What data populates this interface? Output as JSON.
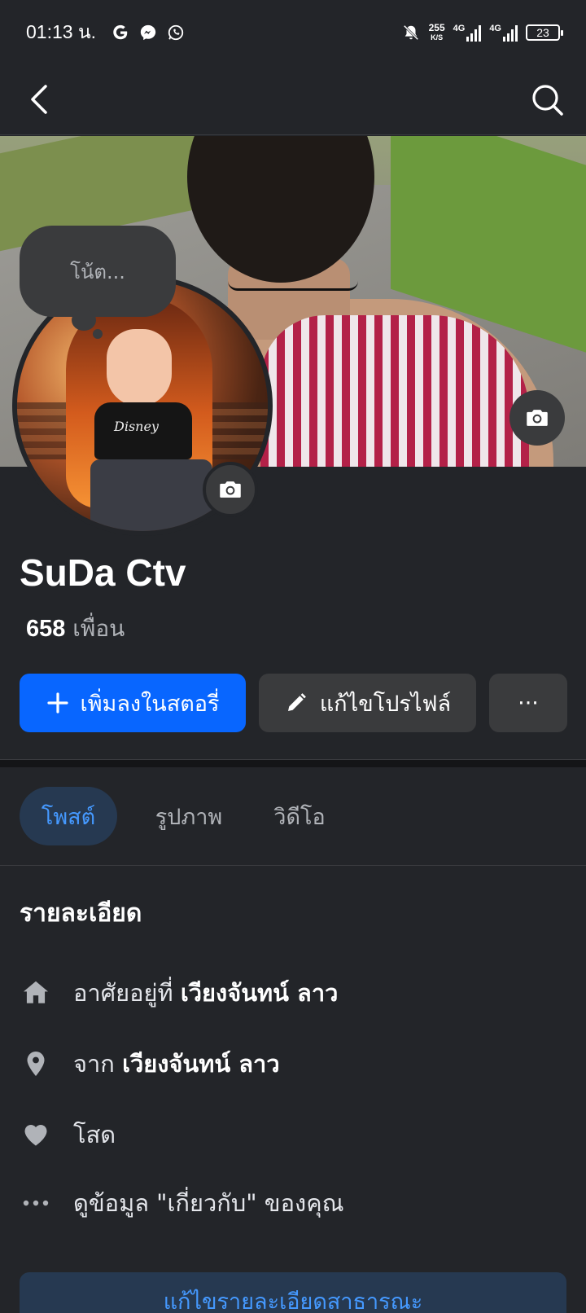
{
  "status_bar": {
    "time": "01:13 น.",
    "net_speed": "255",
    "net_unit": "K/S",
    "signal1_label": "4G",
    "signal2_label": "4G",
    "battery": "23"
  },
  "nav": {
    "back_icon": "chevron-left-icon",
    "search_icon": "search-icon"
  },
  "profile": {
    "note_placeholder": "โน้ต...",
    "name": "SuDa Ctv",
    "friends_count": "658",
    "friends_label": "เพื่อน",
    "avatar_text": "Disney"
  },
  "actions": {
    "add_story": "เพิ่มลงในสตอรี่",
    "edit_profile": "แก้ไขโปรไฟล์",
    "more": "···"
  },
  "tabs": [
    {
      "label": "โพสต์",
      "active": true
    },
    {
      "label": "รูปภาพ",
      "active": false
    },
    {
      "label": "วิดีโอ",
      "active": false
    }
  ],
  "details": {
    "title": "รายละเอียด",
    "lives_prefix": "อาศัยอยู่ที่",
    "lives_value": "เวียงจันทน์ ลาว",
    "from_prefix": "จาก",
    "from_value": "เวียงจันทน์ ลาว",
    "relationship": "โสด",
    "see_about": "ดูข้อมูล \"เกี่ยวกับ\" ของคุณ",
    "edit_public_details": "แก้ไขรายละเอียดสาธารณะ"
  },
  "colors": {
    "background": "#232529",
    "primary_blue": "#0866ff",
    "secondary_button": "#3a3b3d",
    "active_tab_bg": "#263951",
    "active_tab_text": "#4599ff"
  }
}
